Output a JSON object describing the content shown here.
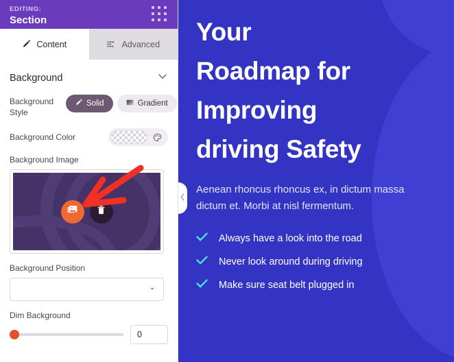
{
  "sidebar": {
    "header": {
      "editing_label": "EDITING:",
      "editing_title": "Section",
      "grid_icon": "grid-dots-icon"
    },
    "tabs": [
      {
        "label": "Content",
        "icon": "pencil-icon",
        "active": true
      },
      {
        "label": "Advanced",
        "icon": "sliders-icon",
        "active": false
      }
    ],
    "background_section": {
      "title": "Background",
      "collapse_icon": "chevron-down-icon",
      "background_style": {
        "label": "Background Style",
        "options": [
          {
            "label": "Solid",
            "icon": "eyedropper-icon",
            "selected": true
          },
          {
            "label": "Gradient",
            "icon": "gradient-icon",
            "selected": false
          }
        ]
      },
      "background_color": {
        "label": "Background Color",
        "swatch_value": "transparent",
        "picker_icon": "palette-icon"
      },
      "background_image": {
        "label": "Background Image",
        "upload_icon": "images-icon",
        "delete_icon": "trash-icon",
        "thumb_color": "#453266",
        "upload_btn_color": "#ef6a33",
        "delete_btn_color": "#2d1a33"
      },
      "background_position": {
        "label": "Background Position",
        "value": "",
        "placeholder": "",
        "caret_icon": "caret-down-icon"
      },
      "dim_background": {
        "label": "Dim Background",
        "value": "0",
        "slider_percent": 0,
        "slider_color": "#e0522a"
      }
    }
  },
  "annotation": {
    "arrow_icon": "red-arrow-icon",
    "arrow_color": "#ee3124"
  },
  "collapse_handle": {
    "icon": "chevron-left-icon"
  },
  "preview": {
    "background_color": "#3434c4",
    "heading_lines": [
      "Your",
      "Roadmap for",
      "Improving",
      "driving Safety"
    ],
    "paragraph": "Aenean rhoncus rhoncus ex, in dictum massa dictum et. Morbi at nisl fermentum.",
    "checklist_icon": "check-icon",
    "checklist_color": "#4fe0e0",
    "checklist": [
      "Always have a look into the road",
      "Never look around during driving",
      "Make sure seat belt plugged in"
    ]
  }
}
